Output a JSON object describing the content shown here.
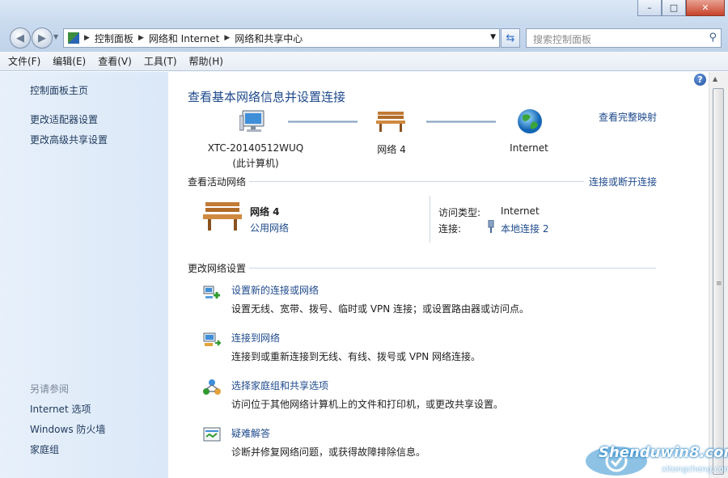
{
  "window": {
    "min_glyph": "–",
    "max_glyph": "□",
    "close_glyph": "✕"
  },
  "address": {
    "crumbs": [
      "控制面板",
      "网络和 Internet",
      "网络和共享中心"
    ],
    "search_placeholder": "搜索控制面板"
  },
  "menu": [
    "文件(F)",
    "编辑(E)",
    "查看(V)",
    "工具(T)",
    "帮助(H)"
  ],
  "sidebar": {
    "links": [
      "控制面板主页",
      "更改适配器设置",
      "更改高级共享设置"
    ],
    "see_also_label": "另请参阅",
    "see_also": [
      "Internet 选项",
      "Windows 防火墙",
      "家庭组"
    ]
  },
  "main": {
    "title": "查看基本网络信息并设置连接",
    "view_full_map": "查看完整映射",
    "network_map": {
      "computer_name": "XTC-20140512WUQ",
      "computer_sub": "(此计算机)",
      "network": "网络  4",
      "internet": "Internet"
    },
    "active_networks": {
      "label": "查看活动网络",
      "connect_link": "连接或断开连接",
      "network_name": "网络  4",
      "network_type": "公用网络",
      "access_type_label": "访问类型:",
      "access_type_value": "Internet",
      "connections_label": "连接:",
      "connections_value": "本地连接 2"
    },
    "change_settings": {
      "label": "更改网络设置",
      "tasks": [
        {
          "title": "设置新的连接或网络",
          "desc": "设置无线、宽带、拨号、临时或 VPN 连接；或设置路由器或访问点。"
        },
        {
          "title": "连接到网络",
          "desc": "连接到或重新连接到无线、有线、拨号或 VPN 网络连接。"
        },
        {
          "title": "选择家庭组和共享选项",
          "desc": "访问位于其他网络计算机上的文件和打印机，或更改共享设置。"
        },
        {
          "title": "疑难解答",
          "desc": "诊断并修复网络问题，或获得故障排除信息。"
        }
      ]
    }
  },
  "watermark": {
    "line1": "Shenduwin8.com",
    "line2": "xitongcheng.com"
  }
}
